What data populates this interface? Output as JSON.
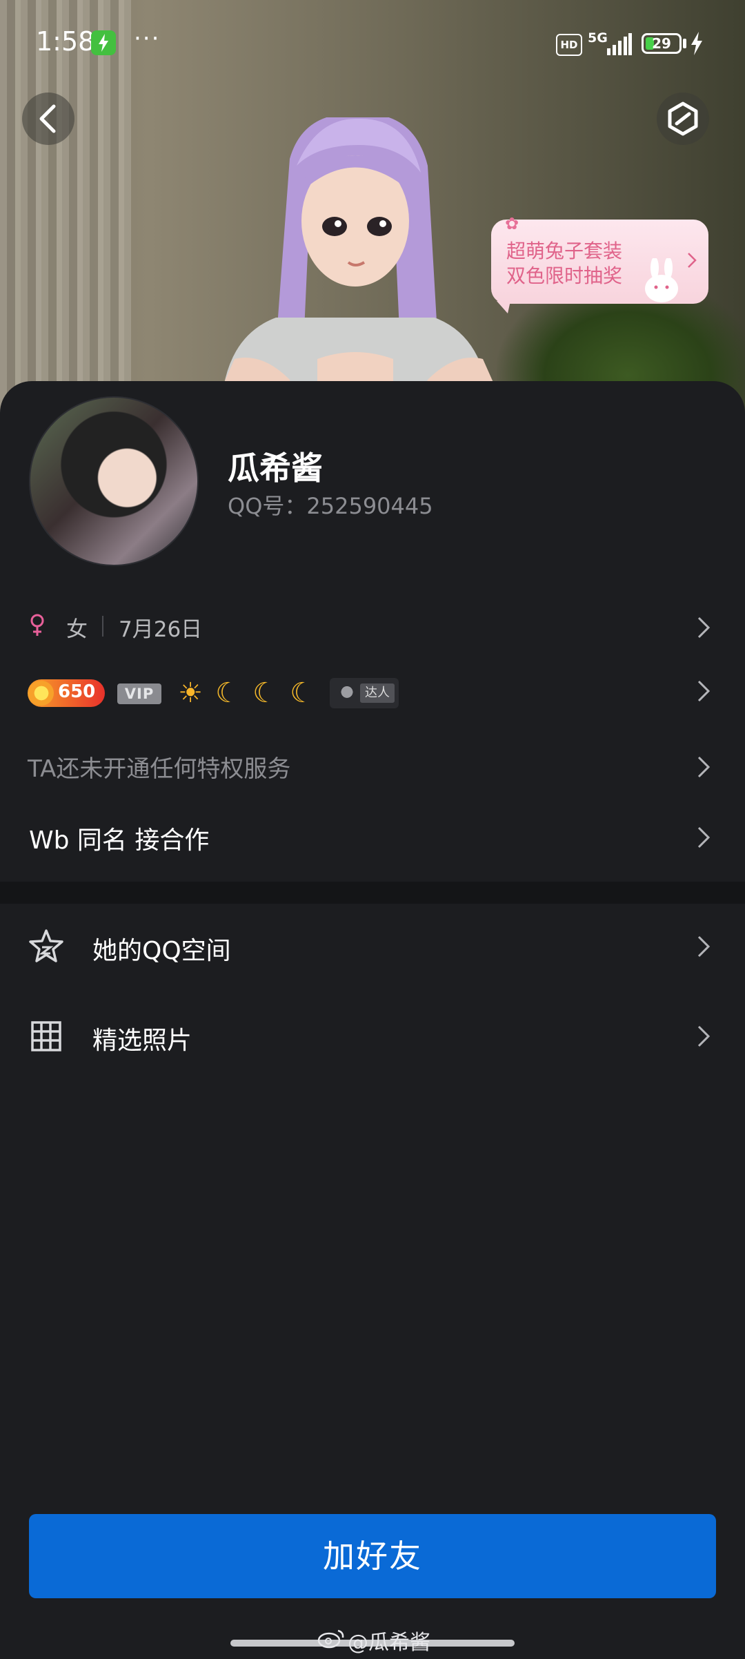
{
  "status_bar": {
    "time": "1:58",
    "more": "···",
    "hd": "HD",
    "network": "5G",
    "battery": "29"
  },
  "promo": {
    "line1": "超萌兔子套装",
    "line2": "双色限时抽奖"
  },
  "profile": {
    "nickname": "瓜希酱",
    "qq_number": "QQ号：252590445",
    "gender": "女",
    "birthday": "7月26日"
  },
  "badges": {
    "level": "650",
    "vip": "VIP",
    "daren": "达人"
  },
  "rows": {
    "privilege": "TA还未开通任何特权服务",
    "signature": "Wb 同名 接合作",
    "qzone": "她的QQ空间",
    "photos": "精选照片"
  },
  "actions": {
    "add_friend": "加好友"
  },
  "watermark": "@瓜希酱",
  "colors": {
    "background": "#1c1d20",
    "primary_button": "#0a6ad6",
    "gender_female": "#e8609a",
    "promo_text": "#e0638a"
  }
}
